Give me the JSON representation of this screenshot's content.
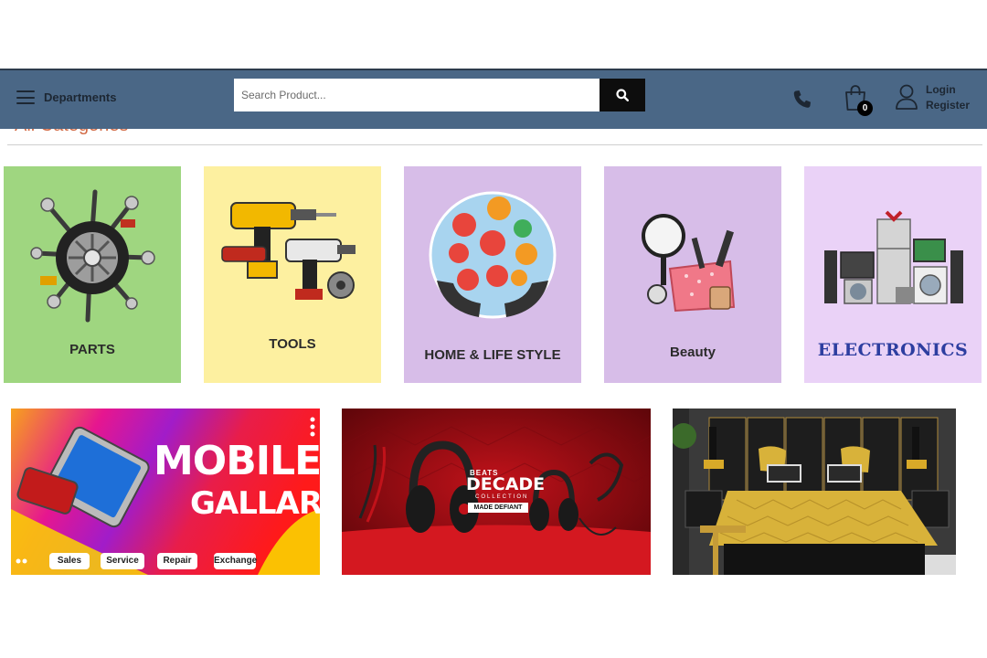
{
  "header": {
    "departments_label": "Departments",
    "search_placeholder": "Search Product...",
    "cart_count": "0",
    "login_label": "Login",
    "register_label": "Register"
  },
  "section_title": "All Categories",
  "categories": [
    {
      "label": "PARTS",
      "bg": "#9fd680"
    },
    {
      "label": "TOOLS",
      "bg": "#fdf0a0"
    },
    {
      "label": "HOME & LIFE STYLE",
      "bg": "#d7bde8"
    },
    {
      "label": "Beauty",
      "bg": "#d7bde8"
    },
    {
      "label": "ELECTRONICS",
      "bg": "#ead2f7"
    }
  ],
  "banners": {
    "mobile": {
      "title_line1": "MOBILE",
      "title_line2": "GALLARY",
      "pills": [
        "Sales",
        "Service",
        "Repair",
        "Exchange"
      ]
    },
    "beats": {
      "brand": "BEATS",
      "headline": "DECADE",
      "sub": "COLLECTION",
      "tag": "MADE DEFIANT"
    }
  },
  "colors": {
    "header_bg": "#4a6786",
    "search_button_bg": "#0d0d0d",
    "title_accent": "#d26a45",
    "electronics_label": "#2d3ea0"
  }
}
